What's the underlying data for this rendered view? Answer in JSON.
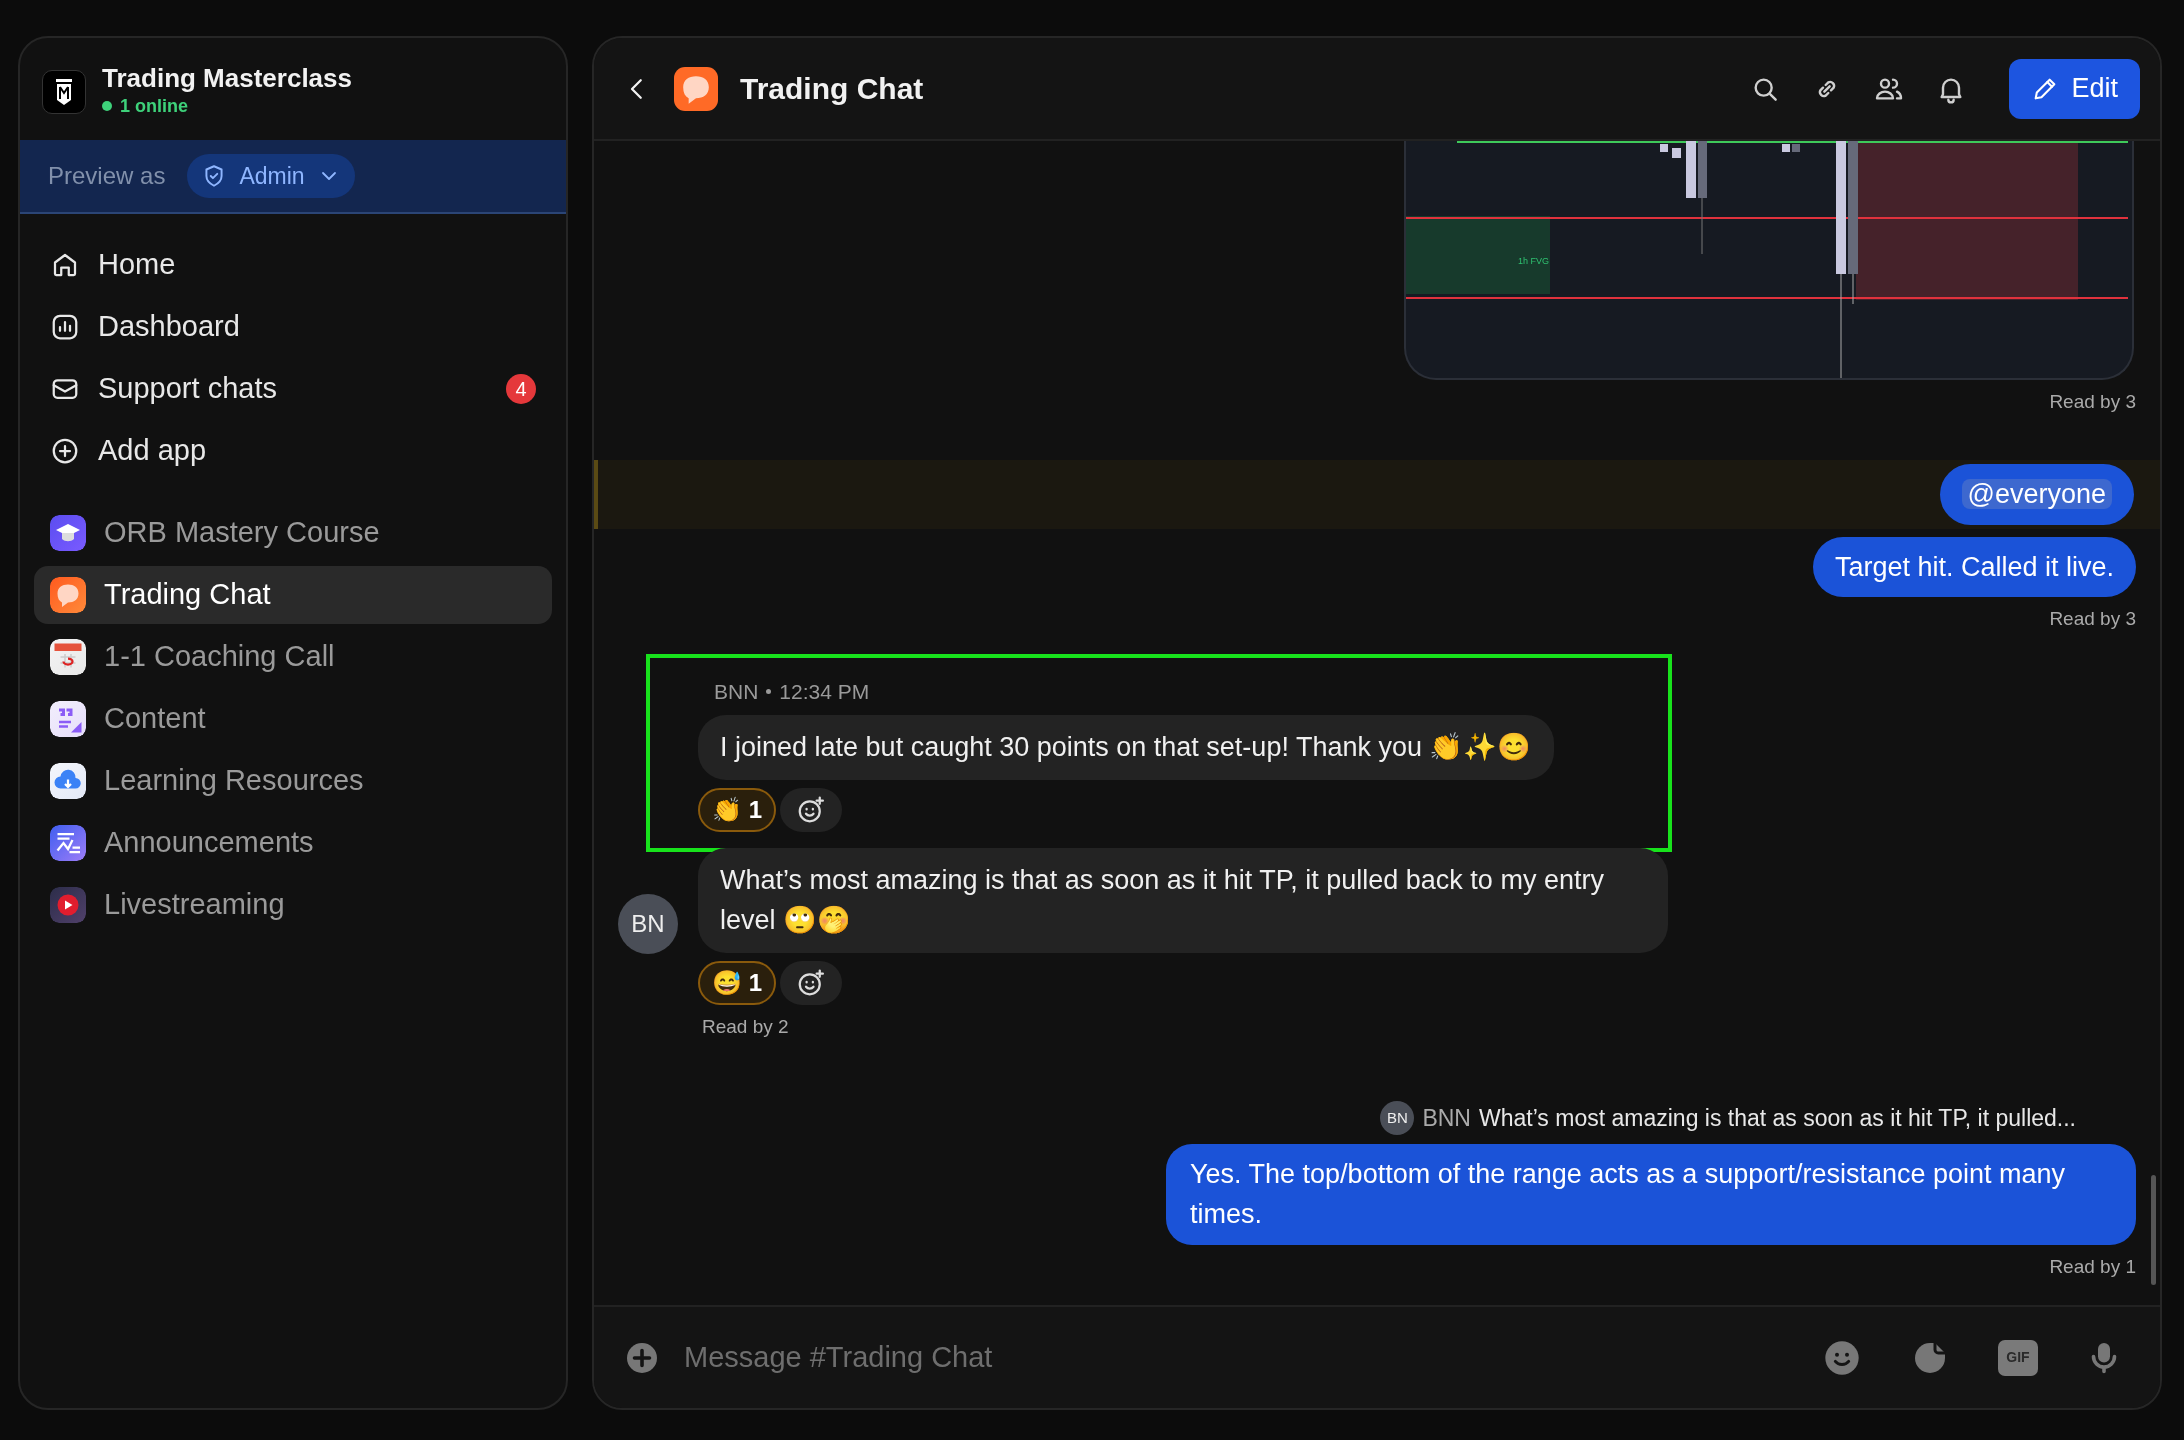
{
  "workspace": {
    "name": "Trading Masterclass",
    "online": "1 online"
  },
  "preview": {
    "label": "Preview as",
    "role": "Admin"
  },
  "nav": [
    {
      "label": "Home",
      "kind": "home"
    },
    {
      "label": "Dashboard",
      "kind": "dashboard"
    },
    {
      "label": "Support chats",
      "kind": "mail",
      "badge": "4"
    },
    {
      "label": "Add app",
      "kind": "add"
    }
  ],
  "apps": [
    {
      "label": "ORB Mastery Course",
      "kind": "course",
      "selected": false
    },
    {
      "label": "Trading Chat",
      "kind": "chat",
      "selected": true
    },
    {
      "label": "1-1 Coaching Call",
      "kind": "calendar",
      "selected": false
    },
    {
      "label": "Content",
      "kind": "quote",
      "selected": false
    },
    {
      "label": "Learning Resources",
      "kind": "cloud",
      "selected": false
    },
    {
      "label": "Announcements",
      "kind": "announce",
      "selected": false
    },
    {
      "label": "Livestreaming",
      "kind": "live",
      "selected": false
    }
  ],
  "chat": {
    "title": "Trading Chat",
    "edit": "Edit"
  },
  "messages": [
    {
      "kind": "image",
      "chart_label": "1h FVG",
      "read": "Read by 3"
    },
    {
      "kind": "outgoing",
      "mention_highlight": true,
      "bubbles": [
        {
          "text": "@everyone",
          "mention": true
        },
        {
          "text": "Target hit. Called it live.",
          "mention": false
        }
      ],
      "read": "Read by 3"
    },
    {
      "kind": "incoming",
      "author": "BNN",
      "time": "12:34 PM",
      "avatar": "BN",
      "bubbles": [
        {
          "text": "I joined late but caught 30 points on that set-up! Thank you 👏✨😊",
          "framed": true,
          "reactions": [
            {
              "emoji": "👏",
              "count": "1",
              "selected": true
            }
          ]
        },
        {
          "text": "What’s most amazing is that as soon as it hit TP, it pulled back to my entry level 🙄🤭",
          "framed": false,
          "reactions": [
            {
              "emoji": "😅",
              "count": "1",
              "selected": true
            }
          ]
        }
      ],
      "read": "Read by 2"
    },
    {
      "kind": "reply",
      "quote": {
        "avatar": "BN",
        "author": "BNN",
        "text": "What’s most amazing is that as soon as it hit TP, it pulled..."
      },
      "bubbles": [
        {
          "text": "Yes. The top/bottom of the range acts as a support/resistance point many times.",
          "mention": false
        }
      ],
      "read": "Read by 1"
    }
  ],
  "composer": {
    "placeholder": "Message #Trading Chat",
    "gif": "GIF"
  }
}
